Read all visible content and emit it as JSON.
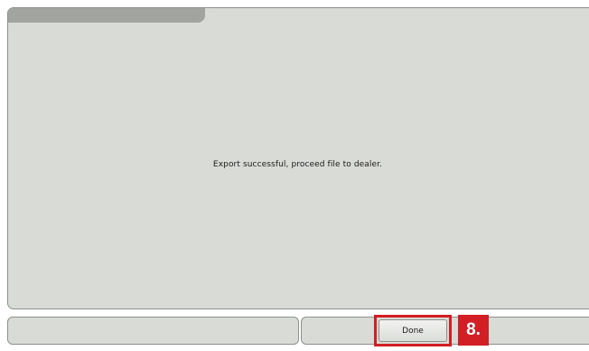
{
  "dialog": {
    "message": "Export successful, proceed file to dealer."
  },
  "actions": {
    "done_label": "Done"
  },
  "annotation": {
    "step_label": "8."
  },
  "colors": {
    "panel_background": "#d9dbd7",
    "title_tab": "#a2a59f",
    "highlight_red": "#d21f26"
  }
}
